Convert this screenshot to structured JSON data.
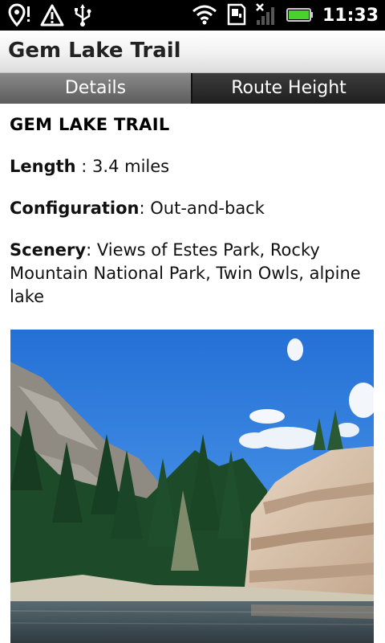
{
  "status_bar": {
    "time": "11:33",
    "left_icons": [
      "location-pin-icon",
      "warning-icon",
      "usb-icon"
    ],
    "right_icons": [
      "wifi-icon",
      "sd-card-icon",
      "signal-icon",
      "battery-icon"
    ]
  },
  "app": {
    "title": "Gem Lake Trail"
  },
  "tabs": [
    {
      "label": "Details",
      "active": true
    },
    {
      "label": "Route Height",
      "active": false
    }
  ],
  "details": {
    "heading": "GEM LAKE TRAIL",
    "length": {
      "label": "Length",
      "sep": " : ",
      "value": "3.4 miles"
    },
    "configuration": {
      "label": "Configuration",
      "sep": ": ",
      "value": "Out-and-back"
    },
    "scenery": {
      "label": "Scenery",
      "sep": ": ",
      "value": "Views of Estes Park, Rocky Mountain National Park, Twin Owls, alpine lake"
    }
  },
  "colors": {
    "status_bar": "#000000",
    "sky": "#2f7fdc",
    "rock": "#d9c3ad",
    "forest": "#1f4f2c"
  }
}
